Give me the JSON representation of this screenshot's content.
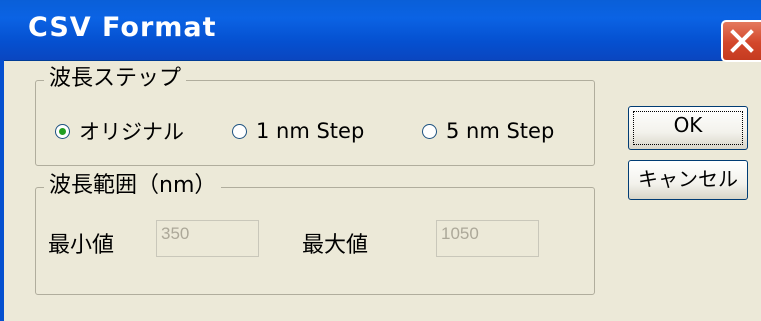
{
  "window": {
    "title": "CSV Format",
    "close_icon": "close-icon"
  },
  "wavelength_step": {
    "legend": "波長ステップ",
    "options": [
      {
        "label": "オリジナル",
        "selected": true
      },
      {
        "label": "1 nm Step",
        "selected": false
      },
      {
        "label": "5 nm Step",
        "selected": false
      }
    ]
  },
  "wavelength_range": {
    "legend": "波長範囲（nm）",
    "min_label": "最小値",
    "min_value": "350",
    "max_label": "最大値",
    "max_value": "1050"
  },
  "buttons": {
    "ok_label": "OK",
    "cancel_label": "キャンセル"
  },
  "colors": {
    "titlebar": "#0550d0",
    "close_button": "#d3472b",
    "dialog_background": "#ece9d8",
    "radio_dot": "#219e21"
  }
}
